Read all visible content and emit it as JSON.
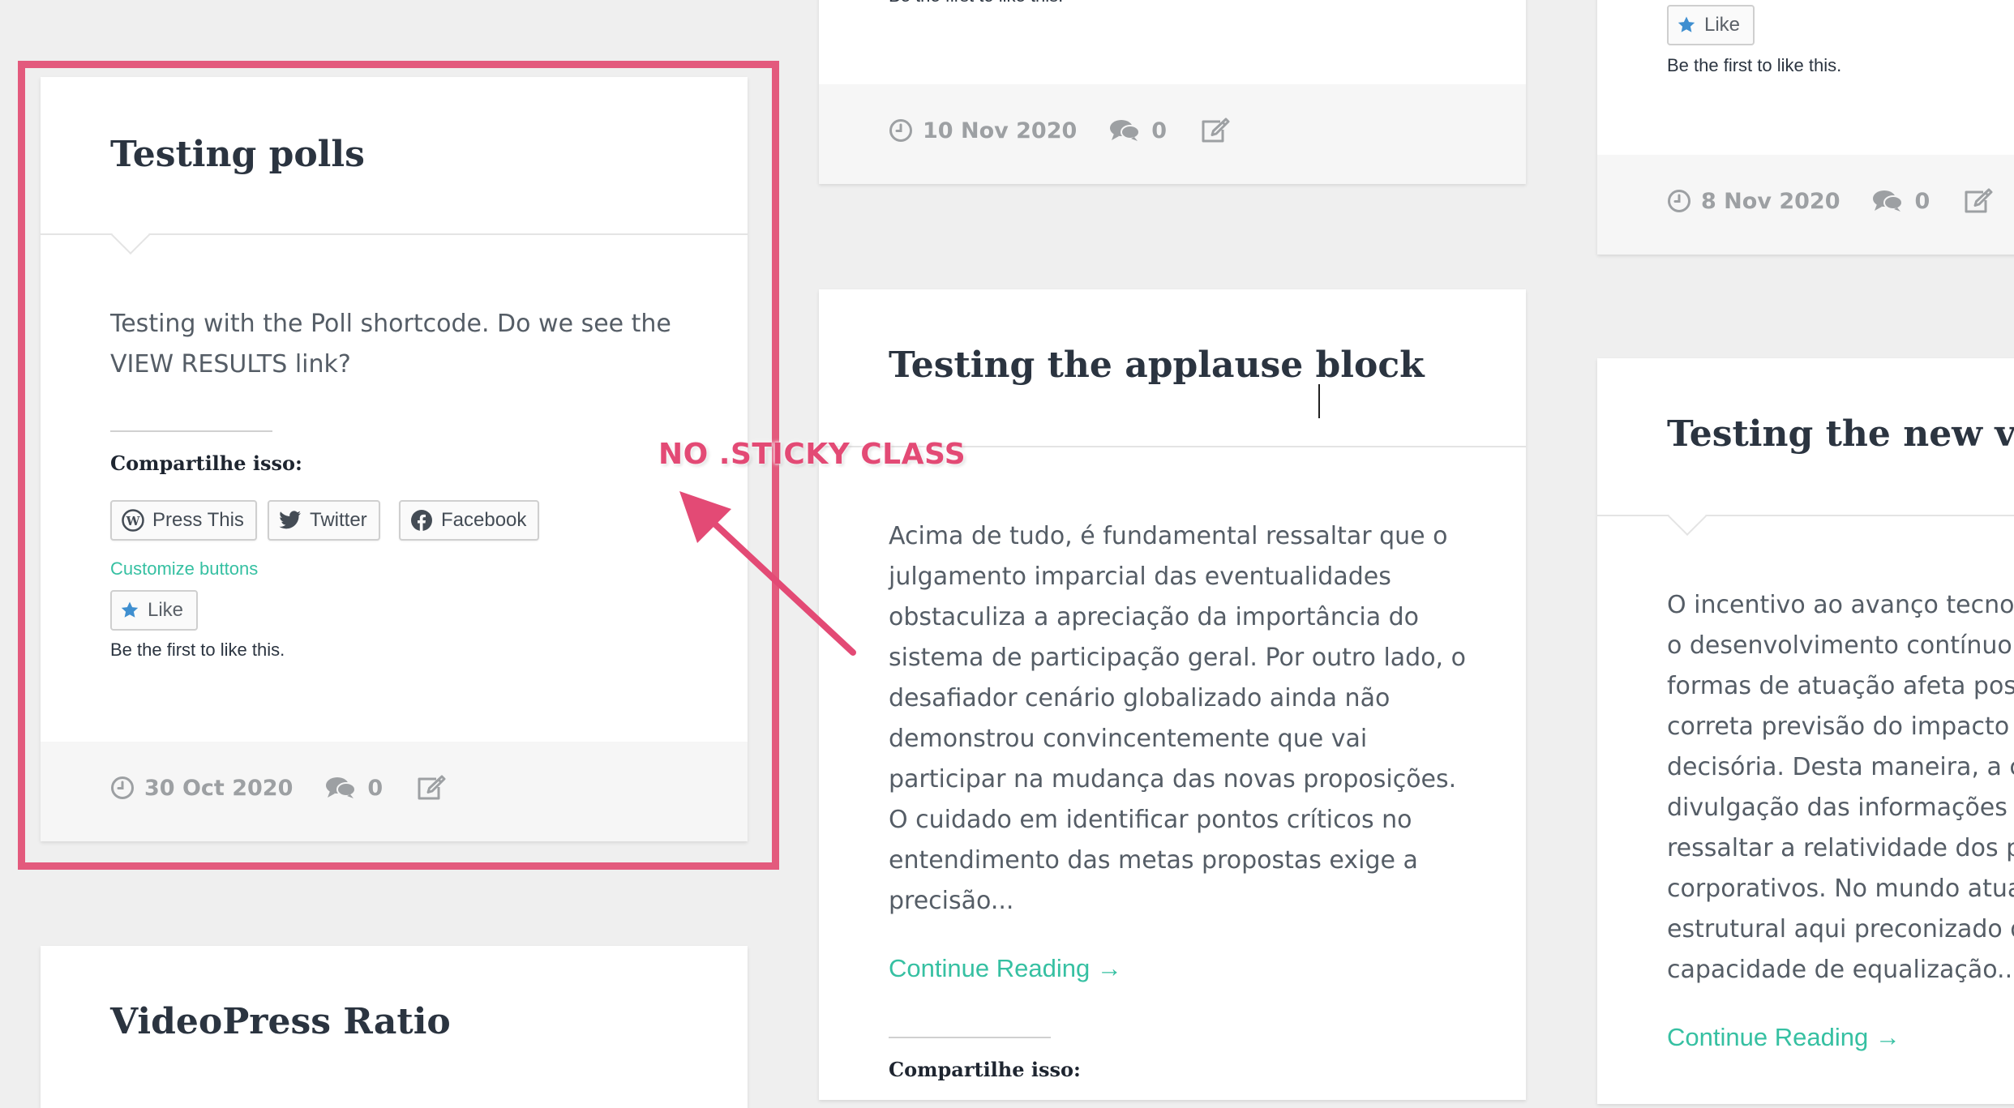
{
  "colors": {
    "background": "#efefef",
    "card": "#ffffff",
    "footer": "#f6f6f6",
    "accent_teal": "#36c0a2",
    "highlight": "#e35a7d",
    "meta_grey": "#9da0a3"
  },
  "icons": {
    "date": "clock-icon",
    "comments": "comments-icon",
    "edit": "edit-icon",
    "like": "star-icon",
    "press_this": "wordpress-icon",
    "twitter": "twitter-icon",
    "facebook": "facebook-icon"
  },
  "posts": {
    "polls": {
      "title": "Testing polls",
      "excerpt": "Testing with the Poll shortcode. Do we see the VIEW RESULTS link?",
      "share_label": "Compartilhe isso:",
      "share_buttons": [
        "Press This",
        "Twitter",
        "Facebook"
      ],
      "customize_link": "Customize buttons",
      "like_label": "Like",
      "like_note": "Be the first to like this.",
      "date": "30 Oct 2020",
      "comments": "0"
    },
    "videopress": {
      "title": "VideoPress Ratio"
    },
    "top_middle": {
      "partial_text": "Be the first to like this.",
      "date": "10 Nov 2020",
      "comments": "0"
    },
    "applause": {
      "title": "Testing the applause block",
      "excerpt": "Acima de tudo, é fundamental ressaltar que o julgamento imparcial das eventualidades obstaculiza a apreciação da importância do sistema de participação geral. Por outro lado, o desafiador cenário globalizado ainda não demonstrou convincentemente que vai participar na mudança das novas proposições. O cuidado em identificar pontos críticos no entendimento das metas propostas exige a precisão...",
      "continue_label": "Continue Reading →",
      "share_label": "Compartilhe isso:"
    },
    "top_right": {
      "like_label": "Like",
      "like_note": "Be the first to like this.",
      "date": "8 Nov 2020",
      "comments": "0"
    },
    "new_vote": {
      "title": "Testing the new vote",
      "excerpt": "O incentivo ao avanço tecnológico, assim como o desenvolvimento contínuo de distintas formas de atuação afeta positivamente a correta previsão do impacto na agilidade decisória. Desta maneira, a constante divulgação das informações talvez venha a ressaltar a relatividade dos paradigmas corporativos. No mundo atual, o novo modelo estrutural aqui preconizado desafia a capacidade de equalização...",
      "continue_label": "Continue Reading →"
    }
  },
  "annotation": {
    "text": "NO .STICKY CLASS"
  }
}
